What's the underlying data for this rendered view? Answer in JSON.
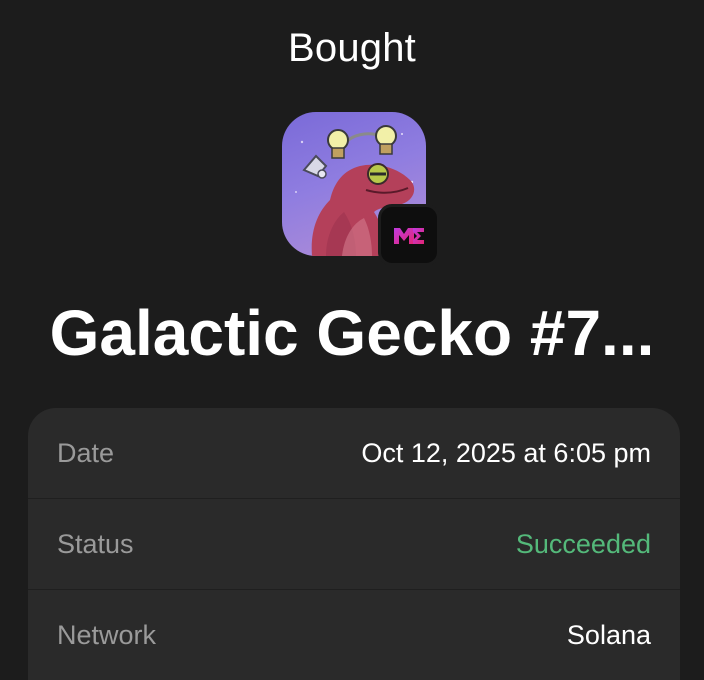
{
  "header": {
    "title": "Bought"
  },
  "nft": {
    "name": "Galactic Gecko #7...",
    "image_icon": "gecko-nft-image",
    "marketplace_icon": "magic-eden-icon",
    "marketplace_color": "#e42575"
  },
  "details": {
    "rows": [
      {
        "label": "Date",
        "value": "Oct 12, 2025 at 6:05 pm",
        "status": "normal"
      },
      {
        "label": "Status",
        "value": "Succeeded",
        "status": "success"
      },
      {
        "label": "Network",
        "value": "Solana",
        "status": "normal"
      }
    ]
  },
  "colors": {
    "background": "#1c1c1c",
    "card": "#2a2a2a",
    "label": "#9a9a9a",
    "success": "#54b97a"
  }
}
